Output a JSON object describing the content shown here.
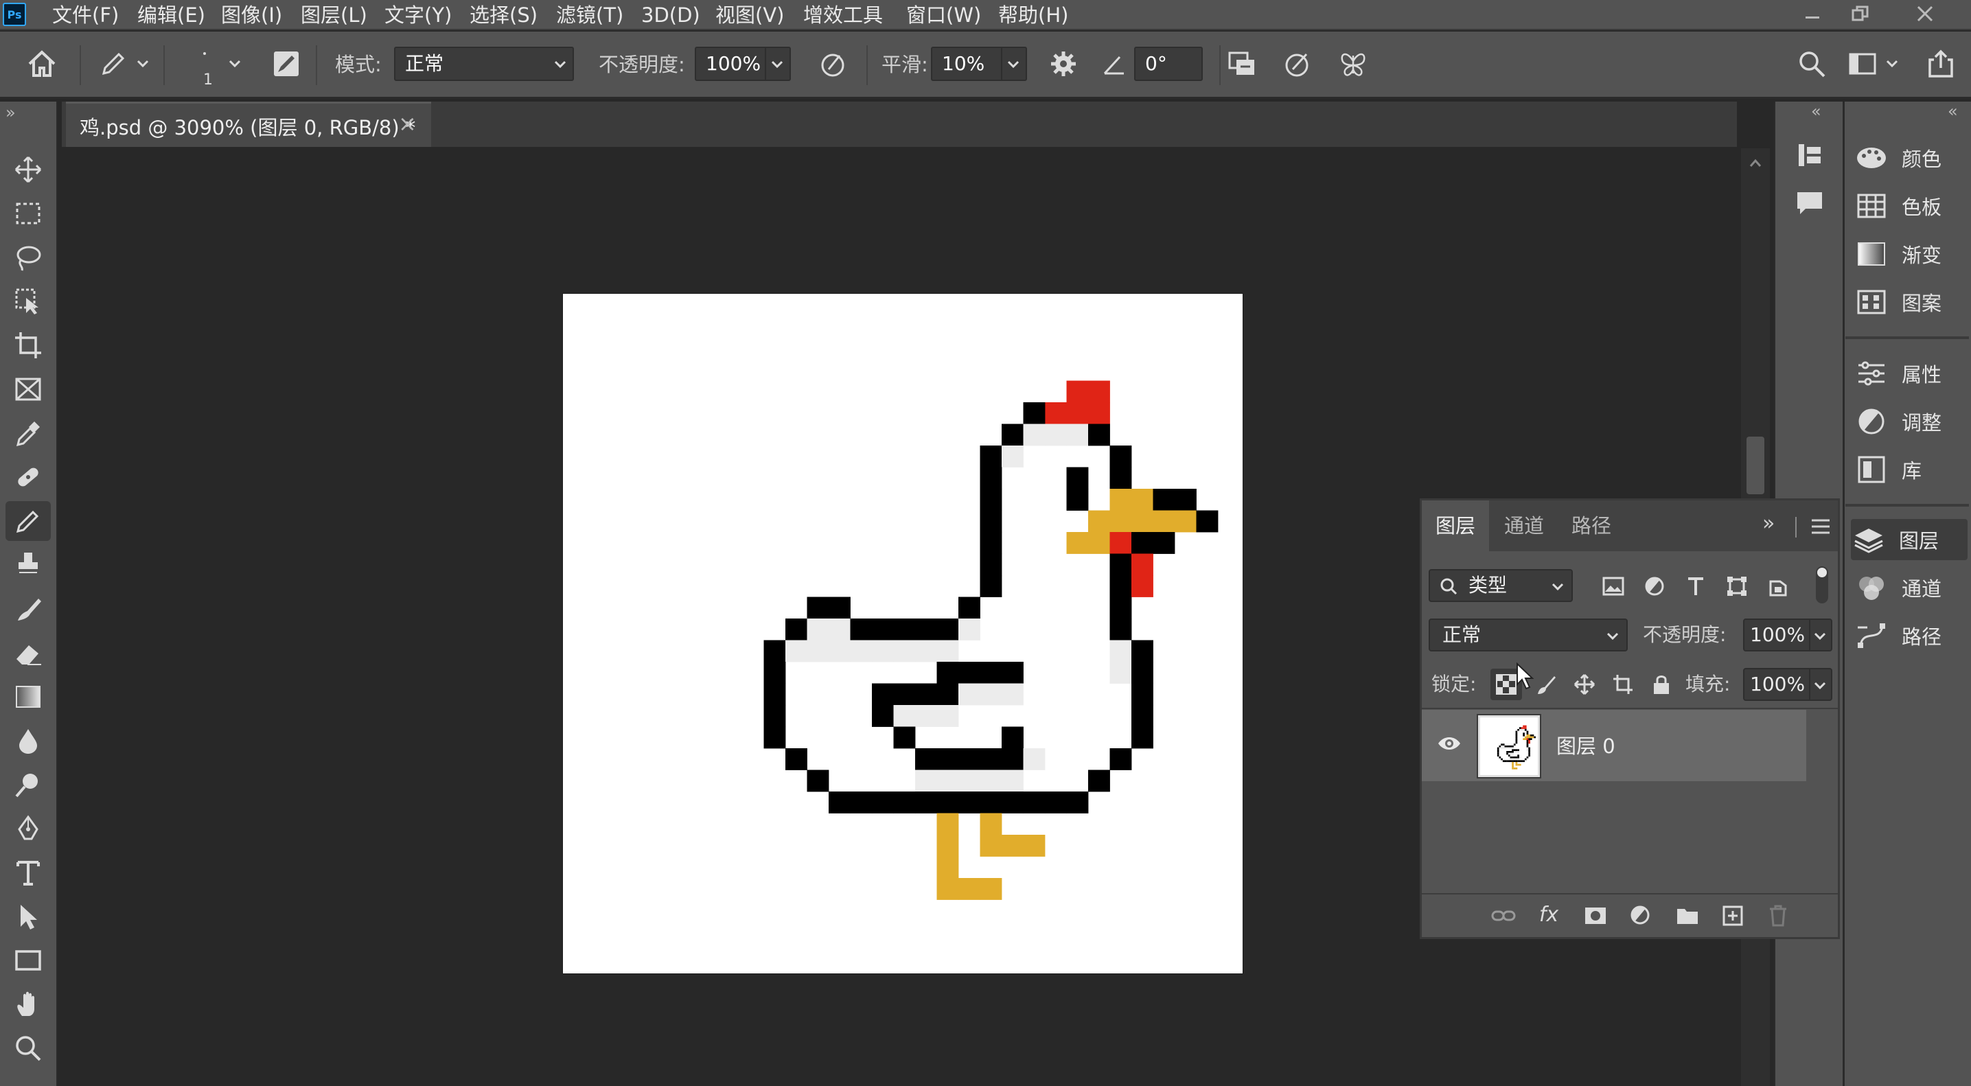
{
  "app": {
    "logo": "Ps",
    "menu": [
      "文件(F)",
      "编辑(E)",
      "图像(I)",
      "图层(L)",
      "文字(Y)",
      "选择(S)",
      "滤镜(T)",
      "3D(D)",
      "视图(V)",
      "增效工具",
      "窗口(W)",
      "帮助(H)"
    ]
  },
  "options": {
    "brush_size": "1",
    "mode_label": "模式:",
    "mode_value": "正常",
    "opacity_label": "不透明度:",
    "opacity_value": "100%",
    "smoothing_label": "平滑:",
    "smoothing_value": "10%",
    "angle_value": "0°"
  },
  "document": {
    "tab_title": "鸡.psd @ 3090% (图层 0, RGB/8) *",
    "close_glyph": "×"
  },
  "tools": [
    "move-tool",
    "marquee-tool",
    "lasso-tool",
    "object-select-tool",
    "crop-tool",
    "frame-tool",
    "eyedropper-tool",
    "healing-brush-tool",
    "pencil-tool",
    "clone-stamp-tool",
    "history-brush-tool",
    "eraser-tool",
    "gradient-tool",
    "blur-tool",
    "dodge-tool",
    "pen-tool",
    "type-tool",
    "path-select-tool",
    "rectangle-tool",
    "hand-tool",
    "zoom-tool"
  ],
  "active_tool": "pencil-tool",
  "right_dock": {
    "items": [
      {
        "label": "颜色",
        "icon": "palette-icon"
      },
      {
        "label": "色板",
        "icon": "swatches-icon"
      },
      {
        "label": "渐变",
        "icon": "gradient-icon"
      },
      {
        "label": "图案",
        "icon": "pattern-icon"
      },
      {
        "label": "属性",
        "icon": "properties-icon"
      },
      {
        "label": "调整",
        "icon": "adjustments-icon"
      },
      {
        "label": "库",
        "icon": "libraries-icon"
      },
      {
        "label": "图层",
        "icon": "layers-icon"
      },
      {
        "label": "通道",
        "icon": "channels-icon"
      },
      {
        "label": "路径",
        "icon": "paths-icon"
      }
    ]
  },
  "layers_panel": {
    "tabs": [
      "图层",
      "通道",
      "路径"
    ],
    "filter_value": "类型",
    "blend_mode": "正常",
    "opacity_label": "不透明度:",
    "opacity_value": "100%",
    "lock_label": "锁定:",
    "fill_label": "填充:",
    "fill_value": "100%",
    "layers": [
      {
        "name": "图层 0",
        "visible": true
      }
    ],
    "footer_fx": "fx"
  },
  "colors": {
    "accent": "#31a8ff",
    "chicken_outline": "#000000",
    "chicken_comb": "#e02416",
    "chicken_beak": "#e1ad2c",
    "chicken_shade": "#ececec"
  }
}
